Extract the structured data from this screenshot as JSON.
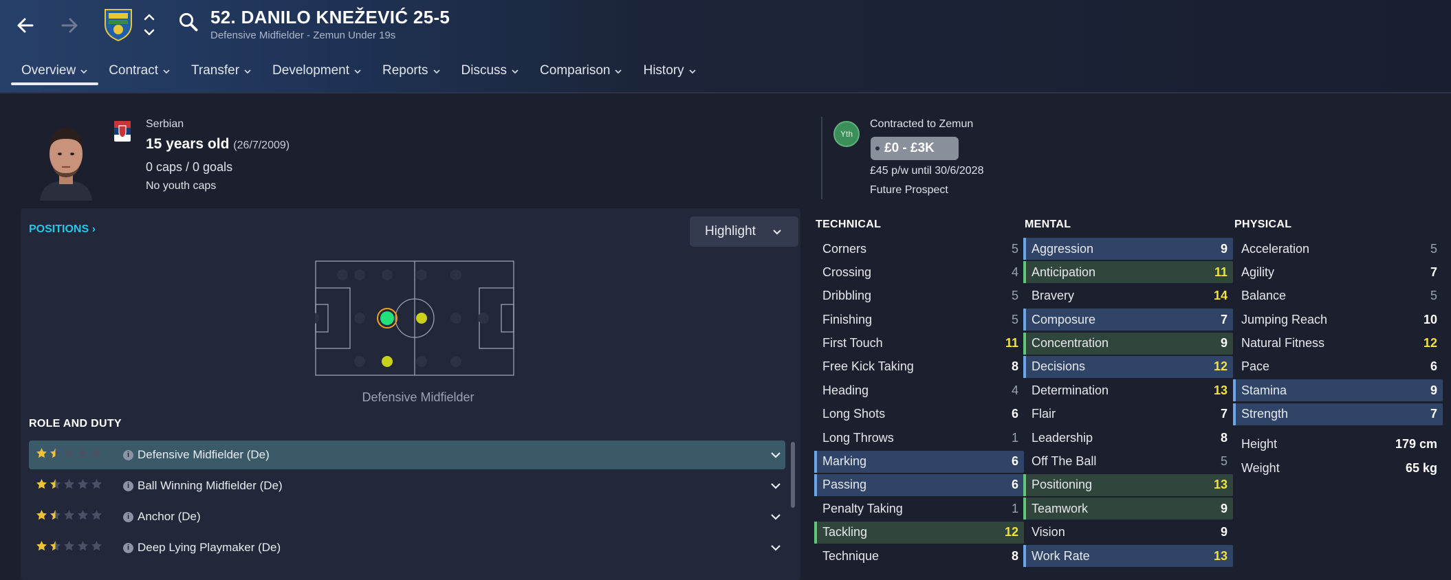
{
  "header": {
    "player_name": "52. DANILO KNEŽEVIĆ 25-5",
    "subtitle": "Defensive Midfielder - Zemun Under 19s",
    "tabs": [
      {
        "label": "Overview"
      },
      {
        "label": "Contract"
      },
      {
        "label": "Transfer"
      },
      {
        "label": "Development"
      },
      {
        "label": "Reports"
      },
      {
        "label": "Discuss"
      },
      {
        "label": "Comparison"
      },
      {
        "label": "History"
      }
    ],
    "icons": [
      "back-arrow-icon",
      "forward-arrow-icon",
      "club-badge-icon",
      "up-down-chevron-icon",
      "search-icon"
    ]
  },
  "profile": {
    "nationality": "Serbian",
    "age": "15 years old",
    "dob": "(26/7/2009)",
    "caps": "0 caps / 0 goals",
    "youth_caps": "No youth caps",
    "yth_badge": "Yth",
    "contracted_to": "Contracted to Zemun",
    "value_range": "£0 - £3K",
    "wage": "£45 p/w until 30/6/2028",
    "prospect": "Future Prospect"
  },
  "positions": {
    "link_label": "POSITIONS",
    "highlight_label": "Highlight",
    "position_label": "Defensive Midfielder",
    "colors": {
      "natural": "#22e07a",
      "accomplished": "#c9d11a",
      "ring": "#f0a020"
    }
  },
  "roles": {
    "title": "ROLE AND DUTY",
    "items": [
      {
        "label": "Defensive Midfielder (De)",
        "stars": 1.5,
        "selected": true
      },
      {
        "label": "Ball Winning Midfielder (De)",
        "stars": 1.5,
        "selected": false
      },
      {
        "label": "Anchor (De)",
        "stars": 1.5,
        "selected": false
      },
      {
        "label": "Deep Lying Playmaker (De)",
        "stars": 1.5,
        "selected": false
      }
    ]
  },
  "technical": {
    "title": "TECHNICAL",
    "rows": [
      {
        "name": "Corners",
        "value": "5",
        "hl": ""
      },
      {
        "name": "Crossing",
        "value": "4",
        "hl": ""
      },
      {
        "name": "Dribbling",
        "value": "5",
        "hl": ""
      },
      {
        "name": "Finishing",
        "value": "5",
        "hl": ""
      },
      {
        "name": "First Touch",
        "value": "11",
        "hl": ""
      },
      {
        "name": "Free Kick Taking",
        "value": "8",
        "hl": ""
      },
      {
        "name": "Heading",
        "value": "4",
        "hl": ""
      },
      {
        "name": "Long Shots",
        "value": "6",
        "hl": ""
      },
      {
        "name": "Long Throws",
        "value": "1",
        "hl": ""
      },
      {
        "name": "Marking",
        "value": "6",
        "hl": "blue"
      },
      {
        "name": "Passing",
        "value": "6",
        "hl": "blue"
      },
      {
        "name": "Penalty Taking",
        "value": "1",
        "hl": ""
      },
      {
        "name": "Tackling",
        "value": "12",
        "hl": "green"
      },
      {
        "name": "Technique",
        "value": "8",
        "hl": ""
      }
    ]
  },
  "mental": {
    "title": "MENTAL",
    "rows": [
      {
        "name": "Aggression",
        "value": "9",
        "hl": "blue"
      },
      {
        "name": "Anticipation",
        "value": "11",
        "hl": "green"
      },
      {
        "name": "Bravery",
        "value": "14",
        "hl": ""
      },
      {
        "name": "Composure",
        "value": "7",
        "hl": "blue"
      },
      {
        "name": "Concentration",
        "value": "9",
        "hl": "green"
      },
      {
        "name": "Decisions",
        "value": "12",
        "hl": "blue"
      },
      {
        "name": "Determination",
        "value": "13",
        "hl": ""
      },
      {
        "name": "Flair",
        "value": "7",
        "hl": ""
      },
      {
        "name": "Leadership",
        "value": "8",
        "hl": ""
      },
      {
        "name": "Off The Ball",
        "value": "5",
        "hl": ""
      },
      {
        "name": "Positioning",
        "value": "13",
        "hl": "green"
      },
      {
        "name": "Teamwork",
        "value": "9",
        "hl": "green"
      },
      {
        "name": "Vision",
        "value": "9",
        "hl": ""
      },
      {
        "name": "Work Rate",
        "value": "13",
        "hl": "blue"
      }
    ]
  },
  "physical": {
    "title": "PHYSICAL",
    "rows": [
      {
        "name": "Acceleration",
        "value": "5",
        "hl": ""
      },
      {
        "name": "Agility",
        "value": "7",
        "hl": ""
      },
      {
        "name": "Balance",
        "value": "5",
        "hl": ""
      },
      {
        "name": "Jumping Reach",
        "value": "10",
        "hl": ""
      },
      {
        "name": "Natural Fitness",
        "value": "12",
        "hl": ""
      },
      {
        "name": "Pace",
        "value": "6",
        "hl": ""
      },
      {
        "name": "Stamina",
        "value": "9",
        "hl": "blue"
      },
      {
        "name": "Strength",
        "value": "7",
        "hl": "blue"
      }
    ],
    "height_label": "Height",
    "height": "179 cm",
    "weight_label": "Weight",
    "weight": "65 kg"
  }
}
